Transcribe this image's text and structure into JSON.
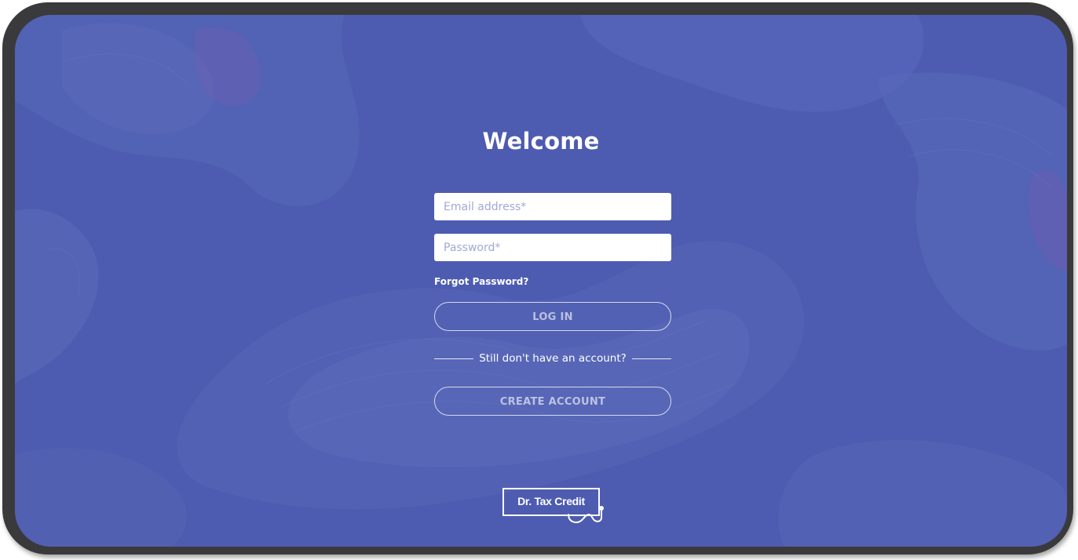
{
  "login": {
    "title": "Welcome",
    "email_placeholder": "Email address*",
    "password_placeholder": "Password*",
    "forgot_label": "Forgot Password?",
    "login_label": "LOG IN",
    "divider_text": "Still don't have an account?",
    "create_label": "CREATE ACCOUNT"
  },
  "brand": {
    "logo_text": "Dr. Tax Credit",
    "logo_icon": "stethoscope-icon"
  },
  "colors": {
    "background": "#4d5cb0",
    "frame": "#3a3a3c",
    "text": "#ffffff",
    "input_bg": "#ffffff"
  }
}
